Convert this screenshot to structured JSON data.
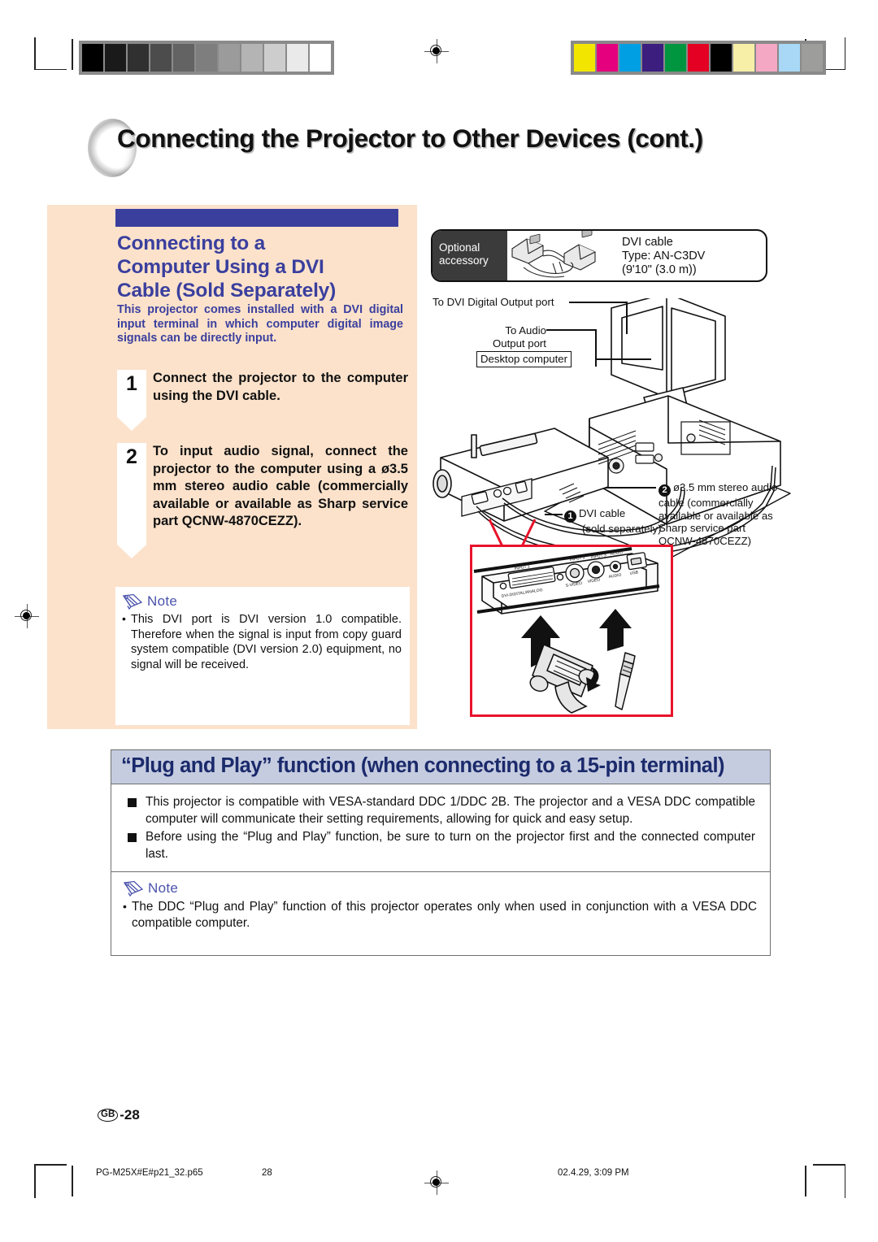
{
  "page": {
    "title": "Connecting the Projector to Other Devices (cont.)",
    "number_locale": "GB",
    "number": "-28"
  },
  "footer": {
    "file": "PG-M25X#E#p21_32.p65",
    "page": "28",
    "date": "02.4.29, 3:09 PM"
  },
  "section": {
    "heading_line1": "Connecting to a",
    "heading_line2": "Computer Using a DVI",
    "heading_line3": "Cable (Sold Separately)",
    "intro": "This projector comes installed with a DVI digital input terminal in which computer digital image signals can be directly input.",
    "steps": [
      {
        "number": "1",
        "text": "Connect the projector to the computer using the DVI cable."
      },
      {
        "number": "2",
        "text": "To input audio signal, connect the projector to the computer using a ø3.5 mm stereo audio cable (commercially available or available as Sharp service part QCNW-4870CEZZ)."
      }
    ]
  },
  "note_left": {
    "label": "Note",
    "items": [
      "This DVI port is DVI version 1.0 compatible. Therefore when the signal is input from copy guard system compatible (DVI version 2.0) equipment, no signal will be received."
    ]
  },
  "diagram": {
    "optional_accessory": {
      "tag_line1": "Optional",
      "tag_line2": "accessory",
      "desc_line1": "DVI cable",
      "desc_line2": "Type: AN-C3DV",
      "desc_line3": "(9'10\" (3.0 m))"
    },
    "labels": {
      "dvi_digital_output_port": "To DVI Digital Output port",
      "to_audio_line1": "To Audio",
      "to_audio_line2": "Output port",
      "desktop_computer": "Desktop computer"
    },
    "callouts": [
      {
        "number": "1",
        "line1": "DVI cable",
        "line2": "(sold separately)"
      },
      {
        "number": "2",
        "text": "ø3.5 mm stereo audio cable (commercially available or available as Sharp service part QCNW-4870CEZZ)"
      }
    ],
    "port_labels": {
      "input1": "INPUT 1",
      "dvi": "DVI-DIGITAL/ANALOG",
      "input2": "INPUT 2",
      "svideo": "S-VIDEO",
      "input3": "INPUT 3",
      "video": "VIDEO",
      "audio_group": "AUDIO",
      "audio": "AUDIO",
      "usb": "USB"
    }
  },
  "plug_and_play": {
    "banner": "“Plug and Play” function (when connecting to a 15-pin terminal)",
    "bullets": [
      "This projector is compatible with VESA-standard DDC 1/DDC 2B. The projector and a VESA DDC compatible computer will communicate their setting requirements, allowing for quick and easy setup.",
      "Before using the “Plug and Play” function, be sure to turn on the projector first and the connected computer last."
    ]
  },
  "note_bottom": {
    "label": "Note",
    "items": [
      "The DDC “Plug and Play” function of this projector operates only when used in conjunction with a VESA DDC compatible computer."
    ]
  },
  "colors": {
    "panel_bg": "#fce2cb",
    "heading_blue": "#3a3f9e",
    "banner_bg": "#c5cce0",
    "banner_text": "#1b2a6b",
    "accent_red": "#e8132b",
    "tag_bg": "#3b3b3b"
  },
  "calibration": {
    "grayscale": [
      "#000000",
      "#1a1a1a",
      "#303030",
      "#4c4c4c",
      "#636363",
      "#7e7e7e",
      "#9b9b9b",
      "#b4b4b4",
      "#cdcdcd",
      "#eaeaea",
      "#ffffff"
    ],
    "colors": [
      "#f2e500",
      "#e5007e",
      "#009fe3",
      "#3b1e7e",
      "#009640",
      "#e30022",
      "#000000",
      "#f7efa8",
      "#f5a8c3",
      "#a8d8f5",
      "#9d9d9c"
    ]
  }
}
